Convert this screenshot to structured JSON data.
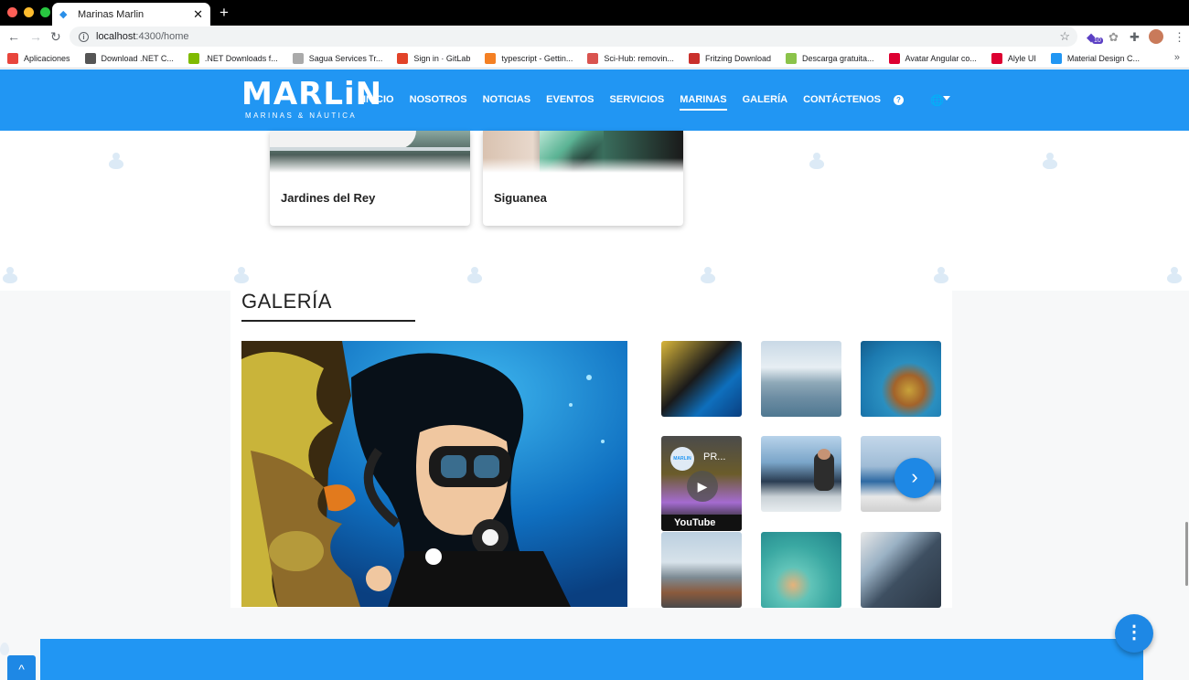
{
  "browser": {
    "tab_title": "Marinas Marlin",
    "tab_close": "✕",
    "new_tab": "+",
    "url_host": "localhost",
    "url_rest": ":4300/home",
    "ext_badge": "10",
    "bookmarks": [
      {
        "label": "Aplicaciones",
        "color": "#e8453c"
      },
      {
        "label": "Download .NET C...",
        "color": "#555555"
      },
      {
        "label": ".NET Downloads f...",
        "color": "#7fba00"
      },
      {
        "label": "Sagua Services Tr...",
        "color": "#aaaaaa"
      },
      {
        "label": "Sign in · GitLab",
        "color": "#e24329"
      },
      {
        "label": "typescript - Gettin...",
        "color": "#f48024"
      },
      {
        "label": "Sci-Hub: removin...",
        "color": "#d9534f"
      },
      {
        "label": "Fritzing Download",
        "color": "#c9302c"
      },
      {
        "label": "Descarga gratuita...",
        "color": "#8bc34a"
      },
      {
        "label": "Avatar Angular co...",
        "color": "#dd0031"
      },
      {
        "label": "Alyle UI",
        "color": "#dd0031"
      },
      {
        "label": "Material Design C...",
        "color": "#2196f3"
      }
    ],
    "bookmarks_more": "»"
  },
  "site": {
    "logo_word": "MARLiN",
    "logo_sub": "MARINAS & NÁUTICA",
    "nav": [
      "INICIO",
      "NOSOTROS",
      "NOTICIAS",
      "EVENTOS",
      "SERVICIOS",
      "MARINAS",
      "GALERÍA",
      "CONTÁCTENOS"
    ],
    "nav_active": "MARINAS",
    "help_icon": "?",
    "globe_icon": "🌐"
  },
  "cards": [
    {
      "label": "Jardines del Rey"
    },
    {
      "label": "Siguanea"
    }
  ],
  "gallery": {
    "title": "GALERÍA",
    "video_channel": "MARLIN",
    "video_title": "PR...",
    "video_brand": "YouTube",
    "next_arrow": "›"
  },
  "fab_icon": "⋮",
  "scroll_top_icon": "^",
  "colors": {
    "brand": "#2196f3",
    "button": "#1e88e5"
  }
}
